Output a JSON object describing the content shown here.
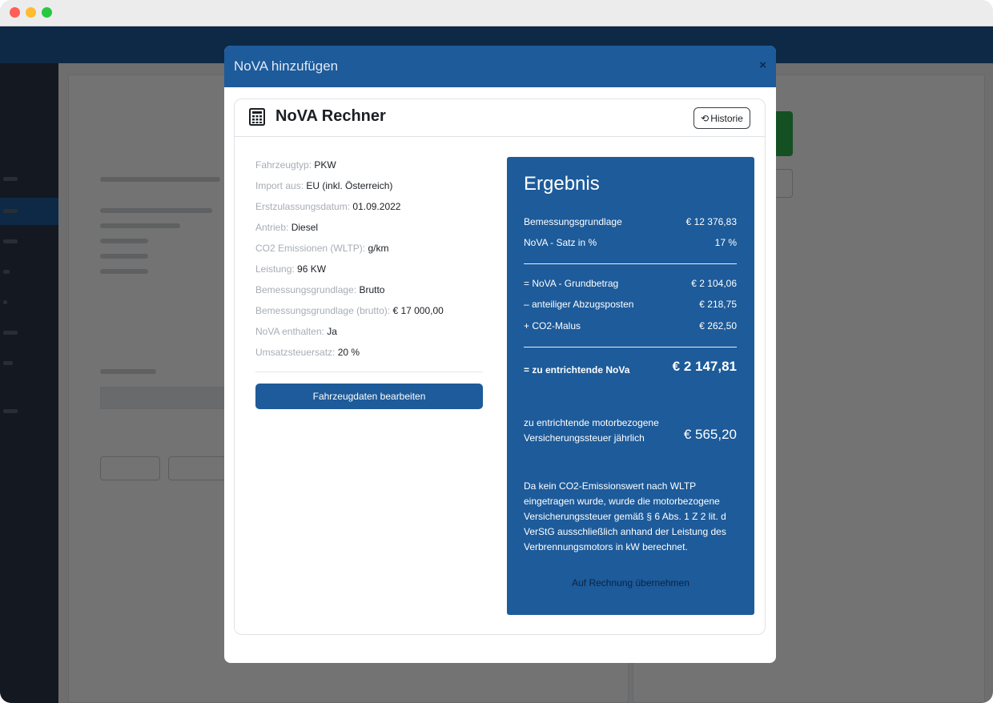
{
  "modal": {
    "title": "NoVA hinzufügen",
    "close_label": "×"
  },
  "card": {
    "icon": "calculator-icon",
    "title": "NoVA Rechner",
    "history_icon": "history-icon",
    "history_label": "Historie"
  },
  "details": [
    {
      "label": "Fahrzeugtyp:",
      "value": "PKW"
    },
    {
      "label": "Import aus:",
      "value": "EU (inkl. Österreich)"
    },
    {
      "label": "Erstzulassungsdatum:",
      "value": "01.09.2022"
    },
    {
      "label": "Antrieb:",
      "value": "Diesel"
    },
    {
      "label": "CO2 Emissionen (WLTP):",
      "value": "g/km"
    },
    {
      "label": "Leistung:",
      "value": "96 KW"
    },
    {
      "label": "Bemessungsgrundlage:",
      "value": "Brutto"
    },
    {
      "label": "Bemessungsgrundlage (brutto):",
      "value": "€ 17 000,00"
    },
    {
      "label": "NoVA enthalten:",
      "value": "Ja"
    },
    {
      "label": "Umsatzsteuersatz:",
      "value": "20 %"
    }
  ],
  "edit_button_label": "Fahrzeugdaten bearbeiten",
  "result": {
    "title": "Ergebnis",
    "rows": [
      {
        "label": "Bemessungsgrundlage",
        "value": "€ 12 376,83"
      },
      {
        "label": "NoVA - Satz in %",
        "value": "17 %"
      },
      {
        "label": "= NoVA - Grundbetrag",
        "value": "€ 2 104,06"
      },
      {
        "label": "– anteiliger Abzugsposten",
        "value": "€ 218,75"
      },
      {
        "label": "+ CO2-Malus",
        "value": "€ 262,50"
      }
    ],
    "total_label": "= zu entrichtende NoVa",
    "total_value": "€ 2 147,81",
    "tax_label": "zu entrichtende motorbezogene Versicherungssteuer jährlich",
    "tax_value": "€ 565,20",
    "note": "Da kein CO2-Emissionswert nach WLTP eingetragen wurde, wurde die motorbezogene Versicherungssteuer gemäß § 6 Abs. 1 Z 2 lit. d VerStG ausschließlich anhand der Leistung des Verbrennungsmotors in kW berechnet.",
    "apply_label": "Auf Rechnung übernehmen"
  },
  "colors": {
    "primary": "#1d5b9a",
    "label_gray": "#a7adb5",
    "overlay": "rgba(0,0,0,0.55)"
  }
}
